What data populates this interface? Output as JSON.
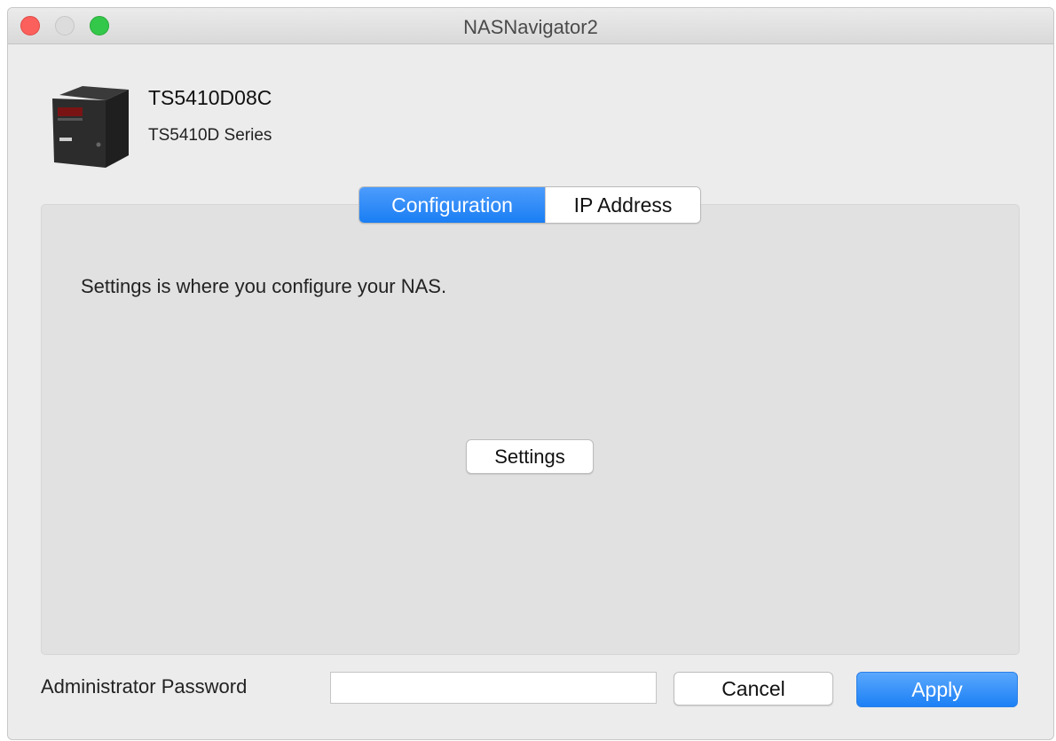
{
  "window": {
    "title": "NASNavigator2"
  },
  "device": {
    "name": "TS5410D08C",
    "series": "TS5410D Series",
    "icon": "nas-device-icon"
  },
  "tabs": [
    {
      "label": "Configuration",
      "selected": true
    },
    {
      "label": "IP Address",
      "selected": false
    }
  ],
  "configuration": {
    "description": "Settings is where you configure your NAS.",
    "settings_button": "Settings"
  },
  "footer": {
    "password_label": "Administrator Password",
    "password_value": "",
    "cancel_label": "Cancel",
    "apply_label": "Apply"
  },
  "colors": {
    "accent": "#1a7ef3",
    "close": "#fc605c",
    "zoom": "#34c84a"
  }
}
